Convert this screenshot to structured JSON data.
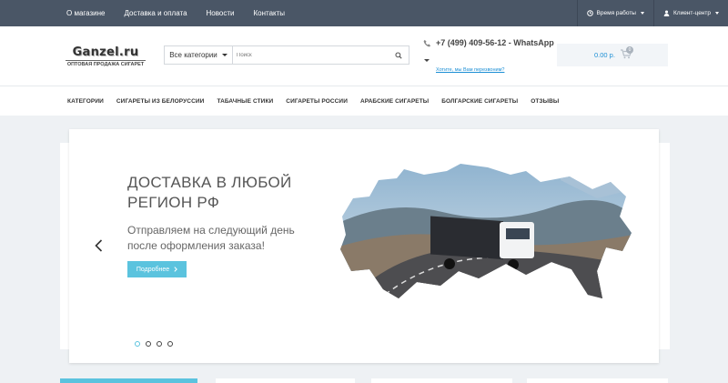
{
  "topbar": {
    "links": [
      "О магазине",
      "Доставка и оплата",
      "Новости",
      "Контакты"
    ],
    "work_hours": "Время работы",
    "client_center": "Клиент-центр"
  },
  "header": {
    "logo_name": "Ganzel.ru",
    "logo_tagline": "ОПТОВАЯ ПРОДАЖА СИГАРЕТ",
    "search_category": "Все категории",
    "search_placeholder": "Поиск",
    "phone": "+7 (499) 409-56-12 - WhatsApp",
    "callback": "Хотите, мы Вам перезвоним?",
    "cart_total": "0.00 р.",
    "cart_count": "0"
  },
  "nav": {
    "items": [
      "Категории",
      "Сигареты из Белоруссии",
      "Табачные стики",
      "Сигареты России",
      "Арабские сигареты",
      "Болгарские сигареты",
      "Отзывы"
    ]
  },
  "slider": {
    "title": "ДОСТАВКА В ЛЮБОЙ РЕГИОН РФ",
    "subtitle": "Отправляем на следующий день после оформления заказа!",
    "button": "Подробнее",
    "dots": 4,
    "active_dot": 0
  },
  "colors": {
    "topbar": "#4a5666",
    "accent": "#5bc3de",
    "link": "#1c8fd5"
  }
}
